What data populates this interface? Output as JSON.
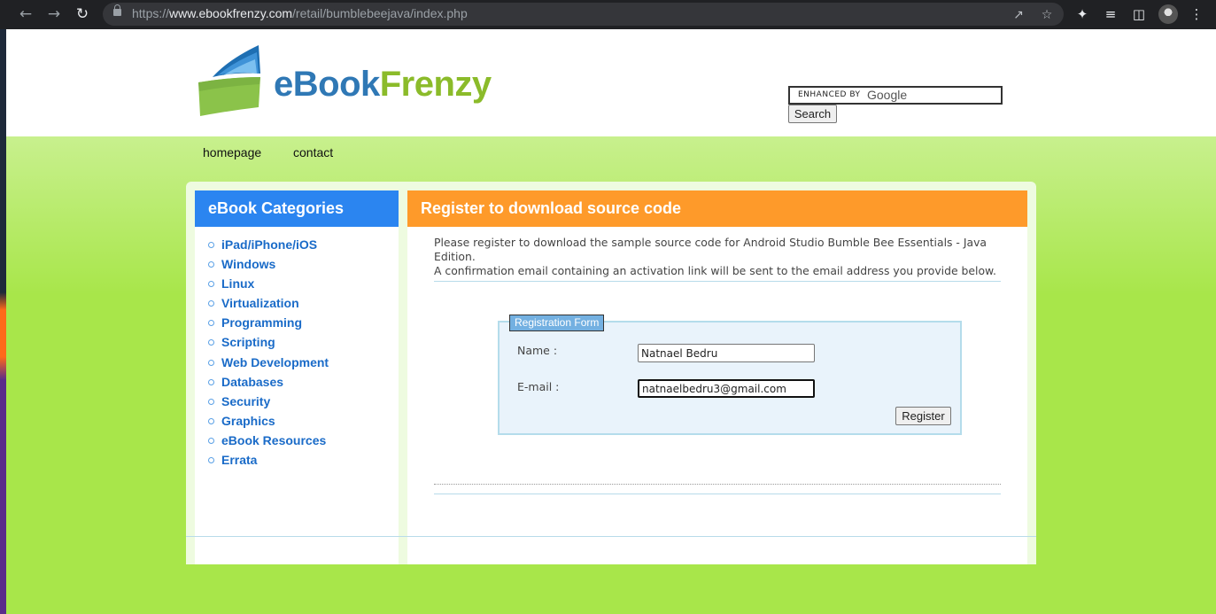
{
  "browser": {
    "url_prefix": "https://",
    "url_domain": "www.ebookfrenzy.com",
    "url_path": "/retail/bumblebeejava/index.php"
  },
  "header": {
    "logo_part1": "eBook",
    "logo_part2": "Frenzy",
    "search_enhanced": "ENHANCED BY",
    "search_google": "Google",
    "search_button": "Search"
  },
  "topnav": [
    "homepage",
    "contact"
  ],
  "sidebar": {
    "title": "eBook Categories",
    "items": [
      "iPad/iPhone/iOS",
      "Windows",
      "Linux",
      "Virtualization",
      "Programming",
      "Scripting",
      "Web Development",
      "Databases",
      "Security",
      "Graphics",
      "eBook Resources",
      "Errata"
    ]
  },
  "main": {
    "title": "Register to download source code",
    "intro_line1": "Please register to download the sample source code for Android Studio Bumble Bee Essentials - Java Edition.",
    "intro_line2": "A confirmation email containing an activation link will be sent to the email address you provide below.",
    "form": {
      "legend": "Registration Form",
      "name_label": "Name :",
      "name_value": "Natnael Bedru",
      "email_label": "E-mail :",
      "email_value": "natnaelbedru3@gmail.com",
      "submit": "Register"
    }
  },
  "colors": {
    "sidebar_header": "#2b85f0",
    "main_header": "#fe9a2a",
    "page_green": "#a8e64a",
    "link_blue": "#1a6bc8"
  }
}
